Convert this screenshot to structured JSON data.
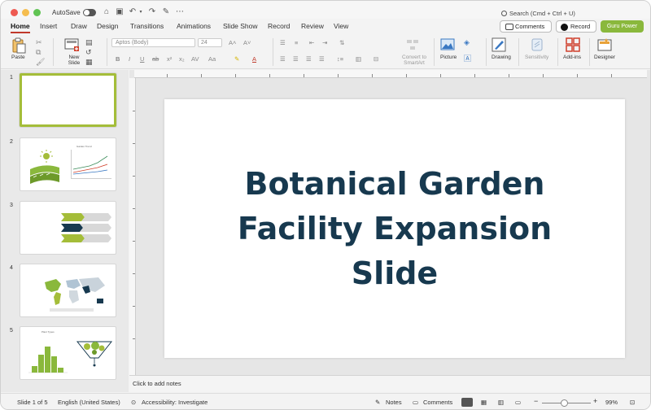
{
  "titlebar": {
    "autosave_label": "AutoSave",
    "search_placeholder": "Search (Cmd + Ctrl + U)"
  },
  "menu": {
    "tabs": [
      "Home",
      "Insert",
      "Draw",
      "Design",
      "Transitions",
      "Animations",
      "Slide Show",
      "Record",
      "Review",
      "View"
    ],
    "active_tab": "Home",
    "comments_label": "Comments",
    "record_label": "Record",
    "guru_label": "Guru Power"
  },
  "ribbon": {
    "paste_label": "Paste",
    "new_slide_label": "New Slide",
    "font_name": "Aptos (Body)",
    "font_size": "24",
    "convert_label": "Convert to SmartArt",
    "picture_label": "Picture",
    "drawing_label": "Drawing",
    "sensitivity_label": "Sensitivity",
    "addins_label": "Add-ins",
    "designer_label": "Designer"
  },
  "slides": [
    {
      "number": "1",
      "selected": true
    },
    {
      "number": "2",
      "mini_title": "Garden Trend"
    },
    {
      "number": "3"
    },
    {
      "number": "4"
    },
    {
      "number": "5",
      "mini_title": "Plant Types"
    }
  ],
  "current_slide": {
    "title": "Botanical Garden Facility Expansion Slide"
  },
  "notes": {
    "placeholder": "Click to add notes"
  },
  "status": {
    "slide_indicator": "Slide 1 of 5",
    "language": "English (United States)",
    "accessibility": "Accessibility: Investigate",
    "notes_label": "Notes",
    "comments_label": "Comments",
    "zoom": "99%"
  },
  "colors": {
    "title_color": "#17394f",
    "accent_green": "#8ab83c",
    "selection_border": "#a4bd39",
    "active_tab_underline": "#c0392b"
  }
}
